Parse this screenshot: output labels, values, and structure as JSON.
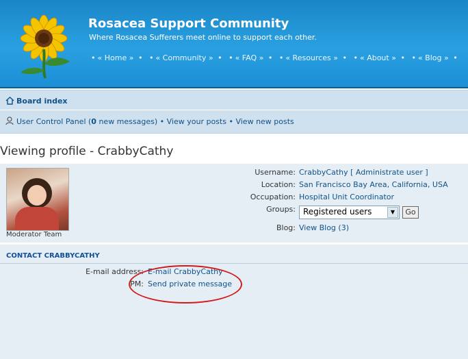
{
  "header": {
    "title": "Rosacea Support Community",
    "description": "Where Rosacea Sufferers meet online to support each other.",
    "nav": [
      "« Home »",
      "« Community »",
      "« FAQ »",
      "« Resources »",
      "« About »",
      "« Blog »"
    ]
  },
  "navbar": {
    "board_index": "Board index",
    "ucp": "User Control Panel (",
    "ucp_count": "0",
    "ucp_tail": " new messages)",
    "view_posts": "View your posts",
    "view_new": "View new posts"
  },
  "page_title": "Viewing profile - CrabbyCathy",
  "profile": {
    "rank": "Moderator Team",
    "username_label": "Username:",
    "username": "CrabbyCathy",
    "admin_link": "[ Administrate user ]",
    "location_label": "Location:",
    "location": "San Francisco Bay Area, California, USA",
    "occupation_label": "Occupation:",
    "occupation": "Hospital Unit Coordinator",
    "groups_label": "Groups:",
    "groups_selected": "Registered users",
    "go_label": "Go",
    "blog_label": "Blog:",
    "blog_link": "View Blog (3)"
  },
  "contact": {
    "title": "CONTACT CRABBYCATHY",
    "email_label": "E-mail address:",
    "email_link": "E-mail CrabbyCathy",
    "pm_label": "PM:",
    "pm_link": "Send private message"
  },
  "colors": {
    "link": "#105289",
    "header": "#2aa0e0",
    "annotation": "#d21a1a"
  }
}
